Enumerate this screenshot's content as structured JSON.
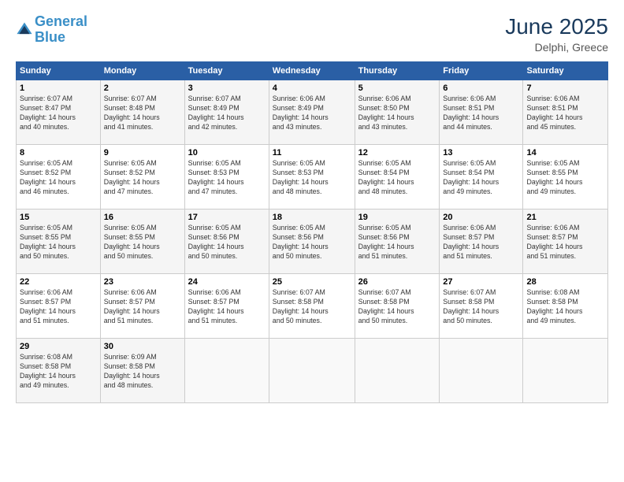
{
  "logo": {
    "line1": "General",
    "line2": "Blue"
  },
  "title": {
    "month_year": "June 2025",
    "location": "Delphi, Greece"
  },
  "weekdays": [
    "Sunday",
    "Monday",
    "Tuesday",
    "Wednesday",
    "Thursday",
    "Friday",
    "Saturday"
  ],
  "weeks": [
    [
      {
        "day": "1",
        "info": "Sunrise: 6:07 AM\nSunset: 8:47 PM\nDaylight: 14 hours\nand 40 minutes."
      },
      {
        "day": "2",
        "info": "Sunrise: 6:07 AM\nSunset: 8:48 PM\nDaylight: 14 hours\nand 41 minutes."
      },
      {
        "day": "3",
        "info": "Sunrise: 6:07 AM\nSunset: 8:49 PM\nDaylight: 14 hours\nand 42 minutes."
      },
      {
        "day": "4",
        "info": "Sunrise: 6:06 AM\nSunset: 8:49 PM\nDaylight: 14 hours\nand 43 minutes."
      },
      {
        "day": "5",
        "info": "Sunrise: 6:06 AM\nSunset: 8:50 PM\nDaylight: 14 hours\nand 43 minutes."
      },
      {
        "day": "6",
        "info": "Sunrise: 6:06 AM\nSunset: 8:51 PM\nDaylight: 14 hours\nand 44 minutes."
      },
      {
        "day": "7",
        "info": "Sunrise: 6:06 AM\nSunset: 8:51 PM\nDaylight: 14 hours\nand 45 minutes."
      }
    ],
    [
      {
        "day": "8",
        "info": "Sunrise: 6:05 AM\nSunset: 8:52 PM\nDaylight: 14 hours\nand 46 minutes."
      },
      {
        "day": "9",
        "info": "Sunrise: 6:05 AM\nSunset: 8:52 PM\nDaylight: 14 hours\nand 47 minutes."
      },
      {
        "day": "10",
        "info": "Sunrise: 6:05 AM\nSunset: 8:53 PM\nDaylight: 14 hours\nand 47 minutes."
      },
      {
        "day": "11",
        "info": "Sunrise: 6:05 AM\nSunset: 8:53 PM\nDaylight: 14 hours\nand 48 minutes."
      },
      {
        "day": "12",
        "info": "Sunrise: 6:05 AM\nSunset: 8:54 PM\nDaylight: 14 hours\nand 48 minutes."
      },
      {
        "day": "13",
        "info": "Sunrise: 6:05 AM\nSunset: 8:54 PM\nDaylight: 14 hours\nand 49 minutes."
      },
      {
        "day": "14",
        "info": "Sunrise: 6:05 AM\nSunset: 8:55 PM\nDaylight: 14 hours\nand 49 minutes."
      }
    ],
    [
      {
        "day": "15",
        "info": "Sunrise: 6:05 AM\nSunset: 8:55 PM\nDaylight: 14 hours\nand 50 minutes."
      },
      {
        "day": "16",
        "info": "Sunrise: 6:05 AM\nSunset: 8:55 PM\nDaylight: 14 hours\nand 50 minutes."
      },
      {
        "day": "17",
        "info": "Sunrise: 6:05 AM\nSunset: 8:56 PM\nDaylight: 14 hours\nand 50 minutes."
      },
      {
        "day": "18",
        "info": "Sunrise: 6:05 AM\nSunset: 8:56 PM\nDaylight: 14 hours\nand 50 minutes."
      },
      {
        "day": "19",
        "info": "Sunrise: 6:05 AM\nSunset: 8:56 PM\nDaylight: 14 hours\nand 51 minutes."
      },
      {
        "day": "20",
        "info": "Sunrise: 6:06 AM\nSunset: 8:57 PM\nDaylight: 14 hours\nand 51 minutes."
      },
      {
        "day": "21",
        "info": "Sunrise: 6:06 AM\nSunset: 8:57 PM\nDaylight: 14 hours\nand 51 minutes."
      }
    ],
    [
      {
        "day": "22",
        "info": "Sunrise: 6:06 AM\nSunset: 8:57 PM\nDaylight: 14 hours\nand 51 minutes."
      },
      {
        "day": "23",
        "info": "Sunrise: 6:06 AM\nSunset: 8:57 PM\nDaylight: 14 hours\nand 51 minutes."
      },
      {
        "day": "24",
        "info": "Sunrise: 6:06 AM\nSunset: 8:57 PM\nDaylight: 14 hours\nand 51 minutes."
      },
      {
        "day": "25",
        "info": "Sunrise: 6:07 AM\nSunset: 8:58 PM\nDaylight: 14 hours\nand 50 minutes."
      },
      {
        "day": "26",
        "info": "Sunrise: 6:07 AM\nSunset: 8:58 PM\nDaylight: 14 hours\nand 50 minutes."
      },
      {
        "day": "27",
        "info": "Sunrise: 6:07 AM\nSunset: 8:58 PM\nDaylight: 14 hours\nand 50 minutes."
      },
      {
        "day": "28",
        "info": "Sunrise: 6:08 AM\nSunset: 8:58 PM\nDaylight: 14 hours\nand 49 minutes."
      }
    ],
    [
      {
        "day": "29",
        "info": "Sunrise: 6:08 AM\nSunset: 8:58 PM\nDaylight: 14 hours\nand 49 minutes."
      },
      {
        "day": "30",
        "info": "Sunrise: 6:09 AM\nSunset: 8:58 PM\nDaylight: 14 hours\nand 48 minutes."
      },
      {
        "day": "",
        "info": ""
      },
      {
        "day": "",
        "info": ""
      },
      {
        "day": "",
        "info": ""
      },
      {
        "day": "",
        "info": ""
      },
      {
        "day": "",
        "info": ""
      }
    ]
  ]
}
